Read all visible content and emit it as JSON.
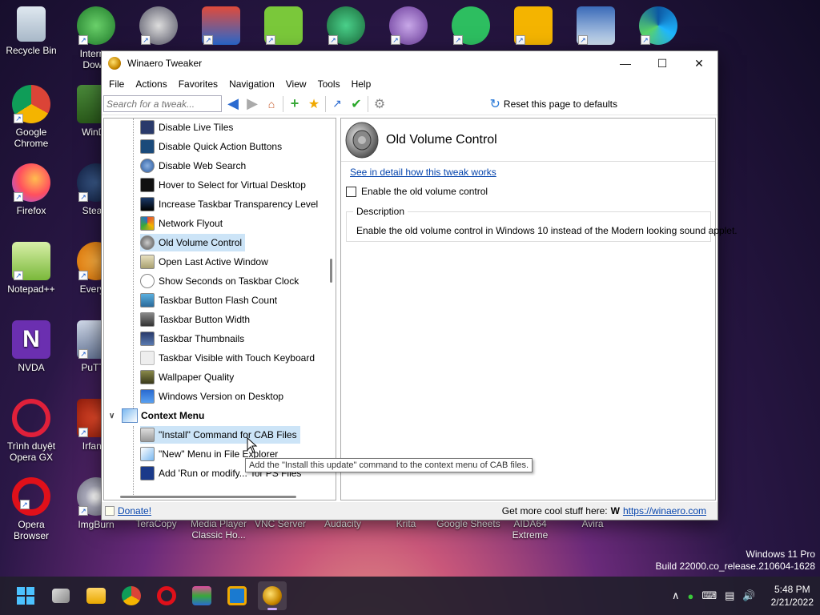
{
  "desktop": {
    "icons": [
      {
        "label": "Recycle Bin"
      },
      {
        "label": "Internet Downl"
      },
      {
        "label": "Google Chrome"
      },
      {
        "label": "WinDir"
      },
      {
        "label": "Firefox"
      },
      {
        "label": "Steam"
      },
      {
        "label": "Notepad++"
      },
      {
        "label": "Everyth"
      },
      {
        "label": "NVDA"
      },
      {
        "label": "PuTTY"
      },
      {
        "label": "Trình duyệt Opera GX"
      },
      {
        "label": "IrfanVi"
      },
      {
        "label": "Opera Browser"
      },
      {
        "label": "ImgBurn"
      }
    ],
    "bottom_labels": [
      "TeraCopy",
      "Media Player Classic Ho...",
      "VNC Server",
      "Audacity",
      "Krita",
      "Google Sheets",
      "AIDA64 Extreme",
      "Avira"
    ]
  },
  "window": {
    "title": "Winaero Tweaker",
    "menu": [
      "File",
      "Actions",
      "Favorites",
      "Navigation",
      "View",
      "Tools",
      "Help"
    ],
    "search_placeholder": "Search for a tweak...",
    "reset_label": "Reset this page to defaults",
    "tree_items": [
      "Disable Live Tiles",
      "Disable Quick Action Buttons",
      "Disable Web Search",
      "Hover to Select for Virtual Desktop",
      "Increase Taskbar Transparency Level",
      "Network Flyout",
      "Old Volume Control",
      "Open Last Active Window",
      "Show Seconds on Taskbar Clock",
      "Taskbar Button Flash Count",
      "Taskbar Button Width",
      "Taskbar Thumbnails",
      "Taskbar Visible with Touch Keyboard",
      "Wallpaper Quality",
      "Windows Version on Desktop"
    ],
    "selected_item": "Old Volume Control",
    "group": "Context Menu",
    "group_items": [
      "\"Install\" Command for CAB Files",
      "\"New\" Menu in File Explorer",
      "Add 'Run or modify...' for PS Files"
    ],
    "detail": {
      "title": "Old Volume Control",
      "link": "See in detail how this tweak works",
      "checkbox_label": "Enable the old volume control",
      "checked": false,
      "description_legend": "Description",
      "description": "Enable the old volume control in Windows 10 instead of the Modern looking sound applet."
    },
    "tooltip": "Add the \"Install this update\" command to the context menu of CAB files.",
    "status": {
      "donate": "Donate!",
      "more": "Get more cool stuff here:",
      "w": "W",
      "site": "https://winaero.com"
    }
  },
  "watermark": {
    "line1": "Windows 11 Pro",
    "line2": "Build 22000.co_release.210604-1628"
  },
  "taskbar": {
    "time": "5:48 PM",
    "date": "2/21/2022"
  }
}
